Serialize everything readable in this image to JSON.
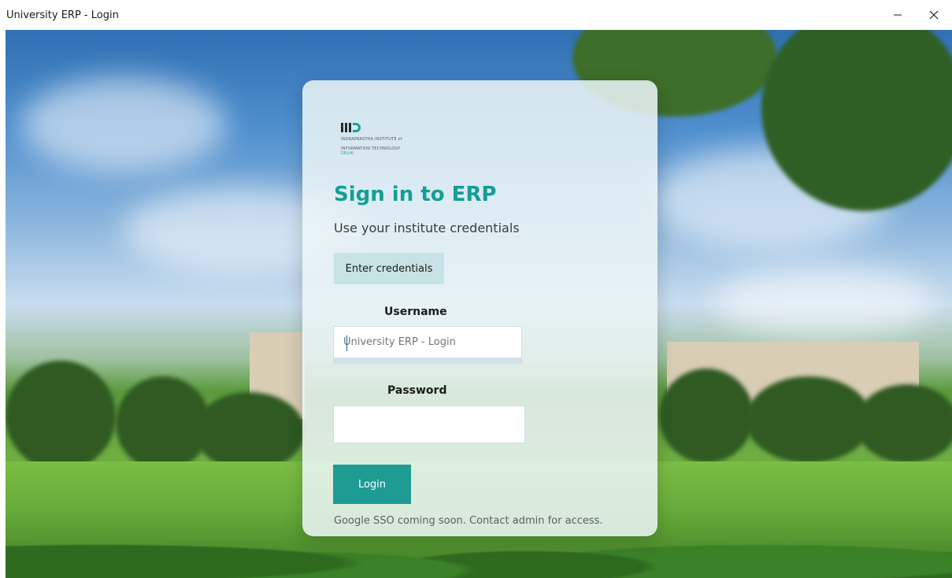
{
  "window": {
    "title": "University ERP - Login",
    "minimize_icon": "minimize-icon",
    "close_icon": "close-icon"
  },
  "brand": {
    "logo_lines": [
      "INDRAPRASTHA INSTITUTE of",
      "INFORMATION TECHNOLOGY"
    ],
    "logo_city": "DELHI",
    "accent_color": "#149e95"
  },
  "login": {
    "heading": "Sign in to ERP",
    "subheading": "Use your institute credentials",
    "tab_label": "Enter credentials",
    "username_label": "Username",
    "username_placeholder": "University ERP - Login",
    "password_label": "Password",
    "login_button": "Login",
    "note": "Google SSO coming soon. Contact admin for access."
  }
}
